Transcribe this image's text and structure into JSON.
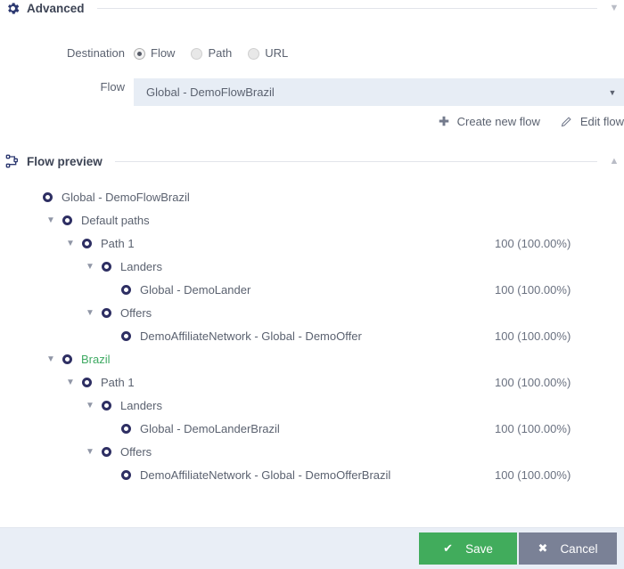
{
  "sections": {
    "advanced": {
      "title": "Advanced",
      "icon": "gear-icon",
      "chevron": "chevron-down-icon"
    },
    "flow_preview": {
      "title": "Flow preview",
      "icon": "flow-icon",
      "chevron": "chevron-up-icon"
    }
  },
  "form": {
    "destination": {
      "label": "Destination",
      "options": [
        {
          "label": "Flow",
          "selected": true
        },
        {
          "label": "Path",
          "selected": false
        },
        {
          "label": "URL",
          "selected": false
        }
      ]
    },
    "flow": {
      "label": "Flow",
      "value": "Global - DemoFlowBrazil",
      "caret": "caret-down-icon"
    }
  },
  "actions": {
    "create_new_flow": {
      "label": "Create new flow",
      "icon": "plus-icon"
    },
    "edit_flow": {
      "label": "Edit flow",
      "icon": "pencil-icon"
    }
  },
  "tree": [
    {
      "level": 0,
      "label": "Global - DemoFlowBrazil",
      "stat": "",
      "caret": "",
      "green": false
    },
    {
      "level": 1,
      "label": "Default paths",
      "stat": "",
      "caret": "chevron-down-icon",
      "green": false
    },
    {
      "level": 2,
      "label": "Path 1",
      "stat": "100 (100.00%)",
      "caret": "chevron-down-icon",
      "green": false
    },
    {
      "level": 3,
      "label": "Landers",
      "stat": "",
      "caret": "chevron-down-icon",
      "green": false
    },
    {
      "level": 4,
      "label": "Global - DemoLander",
      "stat": "100 (100.00%)",
      "caret": "",
      "green": false
    },
    {
      "level": 3,
      "label": "Offers",
      "stat": "",
      "caret": "chevron-down-icon",
      "green": false
    },
    {
      "level": 4,
      "label": "DemoAffiliateNetwork - Global - DemoOffer",
      "stat": "100 (100.00%)",
      "caret": "",
      "green": false
    },
    {
      "level": 1,
      "label": "Brazil",
      "stat": "",
      "caret": "chevron-down-icon",
      "green": true
    },
    {
      "level": 2,
      "label": "Path 1",
      "stat": "100 (100.00%)",
      "caret": "chevron-down-icon",
      "green": false
    },
    {
      "level": 3,
      "label": "Landers",
      "stat": "",
      "caret": "chevron-down-icon",
      "green": false
    },
    {
      "level": 4,
      "label": "Global - DemoLanderBrazil",
      "stat": "100 (100.00%)",
      "caret": "",
      "green": false
    },
    {
      "level": 3,
      "label": "Offers",
      "stat": "",
      "caret": "chevron-down-icon",
      "green": false
    },
    {
      "level": 4,
      "label": "DemoAffiliateNetwork - Global - DemoOfferBrazil",
      "stat": "100 (100.00%)",
      "caret": "",
      "green": false
    }
  ],
  "footer": {
    "save": {
      "label": "Save",
      "icon": "check-icon"
    },
    "cancel": {
      "label": "Cancel",
      "icon": "x-icon"
    }
  },
  "colors": {
    "save_green": "#41ac5c",
    "cancel_gray": "#7a8196",
    "node_navy": "#2e2f63",
    "brazil_green": "#3faa63",
    "field_blue": "#e7edf5",
    "footer_bg": "#e9eef6"
  }
}
